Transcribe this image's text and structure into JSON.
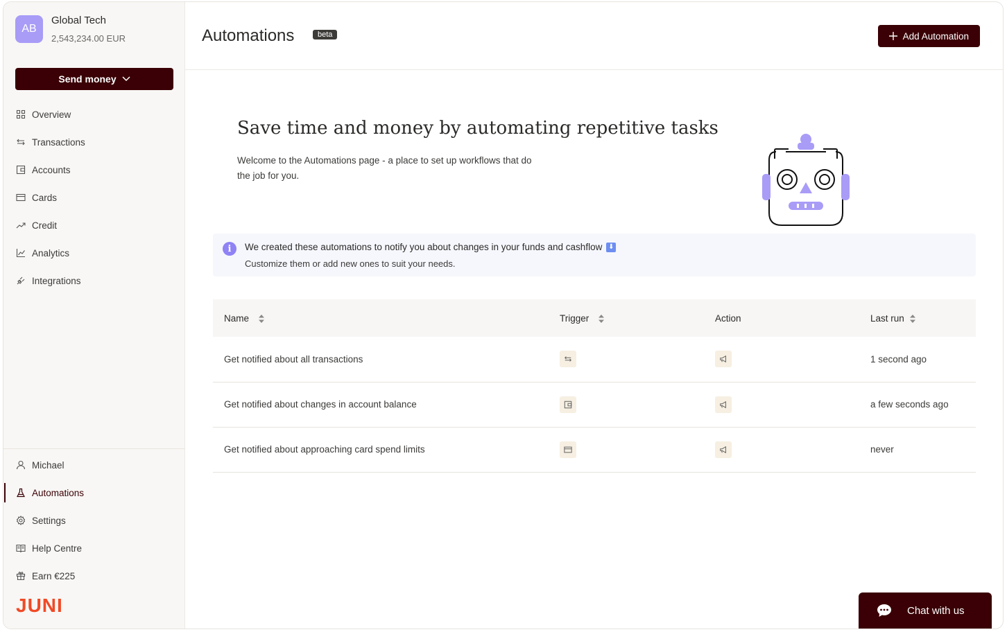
{
  "org": {
    "initials": "AB",
    "name": "Global Tech",
    "balance": "2,543,234.00 EUR"
  },
  "sidebar": {
    "send_money": "Send money",
    "nav": [
      {
        "label": "Overview",
        "icon": "grid-icon"
      },
      {
        "label": "Transactions",
        "icon": "arrows-icon"
      },
      {
        "label": "Accounts",
        "icon": "wallet-icon"
      },
      {
        "label": "Cards",
        "icon": "card-icon"
      },
      {
        "label": "Credit",
        "icon": "trend-icon"
      },
      {
        "label": "Analytics",
        "icon": "chart-icon"
      },
      {
        "label": "Integrations",
        "icon": "plug-icon"
      }
    ],
    "bottom": [
      {
        "label": "Michael",
        "icon": "user-icon"
      },
      {
        "label": "Automations",
        "icon": "flask-icon",
        "active": true
      },
      {
        "label": "Settings",
        "icon": "gear-icon"
      },
      {
        "label": "Help Centre",
        "icon": "book-icon"
      },
      {
        "label": "Earn €225",
        "icon": "gift-icon"
      }
    ],
    "logo": "JUNI"
  },
  "header": {
    "title": "Automations",
    "badge": "beta",
    "add_button": "Add Automation"
  },
  "hero": {
    "title": "Save time and money by automating repetitive tasks",
    "description": "Welcome to the Automations page - a place to set up workflows that do the job for you."
  },
  "info": {
    "line1": "We created these automations to notify you about changes in your funds and cashflow",
    "line2": "Customize them or add new ones to suit your needs."
  },
  "table": {
    "columns": [
      "Name",
      "Trigger",
      "Action",
      "Last run"
    ],
    "rows": [
      {
        "name": "Get notified about all transactions",
        "trigger_icon": "arrows-icon",
        "action_icon": "megaphone-icon",
        "last_run": "1 second ago"
      },
      {
        "name": "Get notified about changes in account balance",
        "trigger_icon": "wallet-icon",
        "action_icon": "megaphone-icon",
        "last_run": "a few seconds ago"
      },
      {
        "name": "Get notified about approaching card spend limits",
        "trigger_icon": "card-icon",
        "action_icon": "megaphone-icon",
        "last_run": "never"
      }
    ]
  },
  "chat": {
    "label": "Chat with us"
  },
  "colors": {
    "brand": "#3a0005",
    "accent": "#a89cf7",
    "logo": "#f04a26"
  }
}
